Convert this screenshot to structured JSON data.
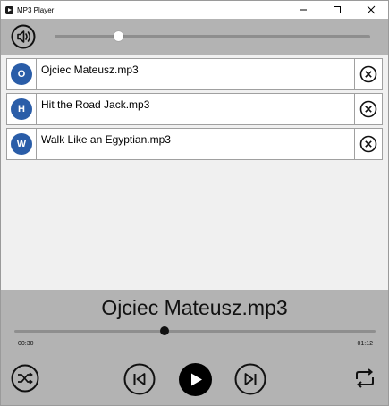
{
  "window": {
    "title": "MP3 Player"
  },
  "volume": {
    "level": 0.2
  },
  "playlist": {
    "tracks": [
      {
        "initial": "O",
        "name": "Ojciec Mateusz.mp3"
      },
      {
        "initial": "H",
        "name": "Hit the Road Jack.mp3"
      },
      {
        "initial": "W",
        "name": "Walk Like an Egyptian.mp3"
      }
    ]
  },
  "player": {
    "now_playing": "Ojciec Mateusz.mp3",
    "elapsed": "00:30",
    "total": "01:12",
    "progress": 0.417
  },
  "colors": {
    "avatar": "#2a5da8",
    "bar_background": "#b3b3b3"
  },
  "icons": {
    "volume": "speaker-icon",
    "remove": "circle-x-icon",
    "shuffle": "shuffle-icon",
    "previous": "skip-previous-icon",
    "play": "play-icon",
    "next": "skip-next-icon",
    "repeat": "repeat-icon"
  }
}
